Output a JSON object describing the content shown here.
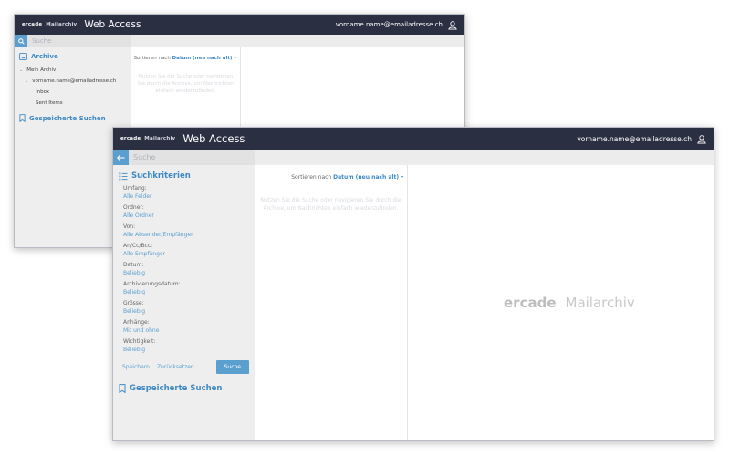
{
  "header": {
    "brand": "ercade",
    "brand_sub": "Mailarchiv",
    "title": "Web Access",
    "user_email": "vorname.name@emailadresse.ch"
  },
  "search": {
    "placeholder": "Suche"
  },
  "archive_view": {
    "archive_title": "Archive",
    "tree": [
      {
        "label": "Mein Archiv"
      },
      {
        "label": "vorname.name@emailadresse.ch"
      },
      {
        "label": "Inbox"
      },
      {
        "label": "Sent Items"
      }
    ],
    "saved_searches": "Gespeicherte Suchen",
    "sort_prefix": "Sortieren nach",
    "sort_value": "Datum (neu nach alt)",
    "hint": "Nutzen Sie die Suche oder navigieren Sie durch die Archive, um Nachrichten einfach wiederzufinden."
  },
  "search_view": {
    "criteria_title": "Suchkriterien",
    "criteria": [
      {
        "label": "Umfang:",
        "value": "Alle Felder"
      },
      {
        "label": "Ordner:",
        "value": "Alle Ordner"
      },
      {
        "label": "Von:",
        "value": "Alle Absender/Empfänger"
      },
      {
        "label": "An/Cc/Bcc:",
        "value": "Alle Empfänger"
      },
      {
        "label": "Datum:",
        "value": "Beliebig"
      },
      {
        "label": "Archivierungsdatum:",
        "value": "Beliebig"
      },
      {
        "label": "Grösse:",
        "value": "Beliebig"
      },
      {
        "label": "Anhänge:",
        "value": "Mit und ohne"
      },
      {
        "label": "Wichtigkeit:",
        "value": "Beliebig"
      }
    ],
    "save_label": "Speichern",
    "reset_label": "Zurücksetzen",
    "search_label": "Suche",
    "saved_searches": "Gespeicherte Suchen",
    "sort_prefix": "Sortieren nach",
    "sort_value": "Datum (neu nach alt)",
    "hint": "Nutzen Sie die Suche oder navigieren Sie durch die Archive, um Nachrichten einfach wiederzufinden.",
    "logo_word1": "ercade",
    "logo_word2": "Mailarchiv"
  },
  "colors": {
    "topbar": "#2b2f42",
    "accent": "#5b9fcf",
    "link": "#3e89c4",
    "sidebar": "#eeeeee"
  },
  "icons": [
    "search-icon",
    "back-arrow-icon",
    "user-icon",
    "archive-icon",
    "filter-list-icon",
    "saved-search-icon",
    "chevron-down-icon"
  ]
}
